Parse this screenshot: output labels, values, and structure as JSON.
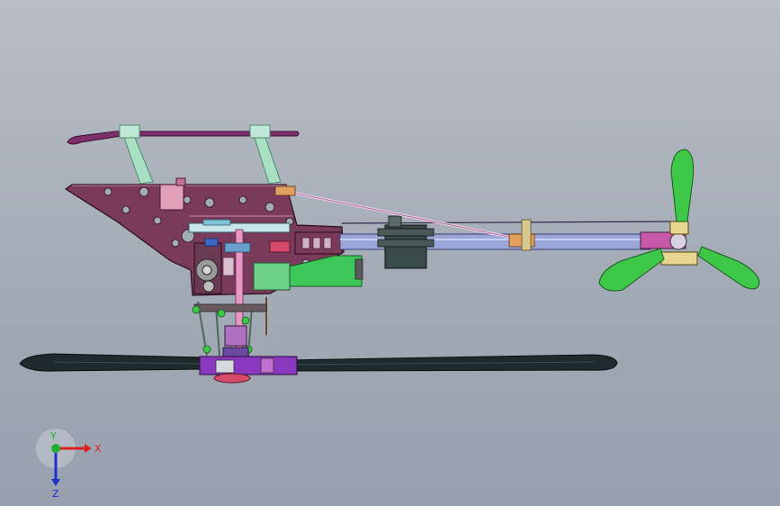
{
  "viewport": {
    "background_top": "#b8bec6",
    "background_bottom": "#97a0ad"
  },
  "triad": {
    "x_label": "X",
    "y_label": "Y",
    "z_label": "Z",
    "x_color": "#e02020",
    "y_color": "#20b030",
    "z_color": "#2030d0"
  },
  "model": {
    "frame_color": "#7a3a5a",
    "canopy_color": "#8a3070",
    "blade_color": "#1a2a2a",
    "tail_blade_color": "#3ec848",
    "boom_color": "#9aa6d8",
    "servo_color": "#3aa84a",
    "hub_color": "#8a38c0"
  }
}
